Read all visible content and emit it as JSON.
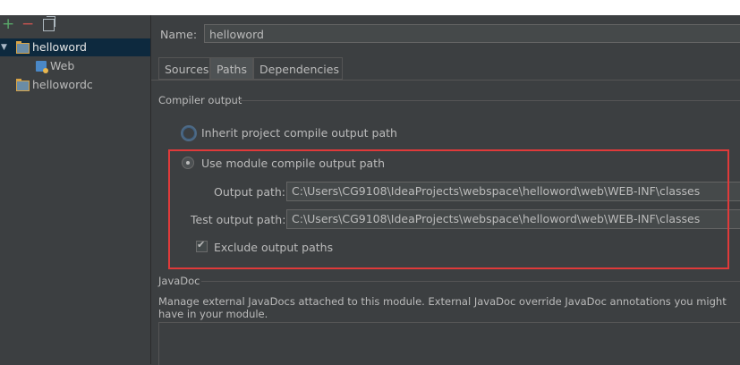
{
  "toolbar": {
    "add": "+",
    "remove": "−"
  },
  "tree": {
    "items": [
      {
        "label": "helloword",
        "selected": true,
        "expanded": true
      },
      {
        "label": "Web",
        "child": true
      },
      {
        "label": "hellowordc"
      }
    ]
  },
  "name": {
    "label": "Name:",
    "value": "helloword"
  },
  "tabs": [
    {
      "label": "Sources"
    },
    {
      "label": "Paths",
      "active": true
    },
    {
      "label": "Dependencies"
    }
  ],
  "compiler": {
    "title": "Compiler output",
    "inherit_label": "Inherit project compile output path",
    "use_module_label": "Use module compile output path",
    "output_path_label": "Output path:",
    "output_path_value": "C:\\Users\\CG9108\\IdeaProjects\\webspace\\helloword\\web\\WEB-INF\\classes",
    "test_output_path_label": "Test output path:",
    "test_output_path_value": "C:\\Users\\CG9108\\IdeaProjects\\webspace\\helloword\\web\\WEB-INF\\classes",
    "exclude_label": "Exclude output paths",
    "exclude_checked": true
  },
  "javadoc": {
    "title": "JavaDoc",
    "description": "Manage external JavaDocs attached to this module. External JavaDoc override JavaDoc annotations you might have in your module."
  },
  "colors": {
    "highlight": "#e03a3a",
    "selection": "#0d293e",
    "background": "#3c3f41"
  }
}
